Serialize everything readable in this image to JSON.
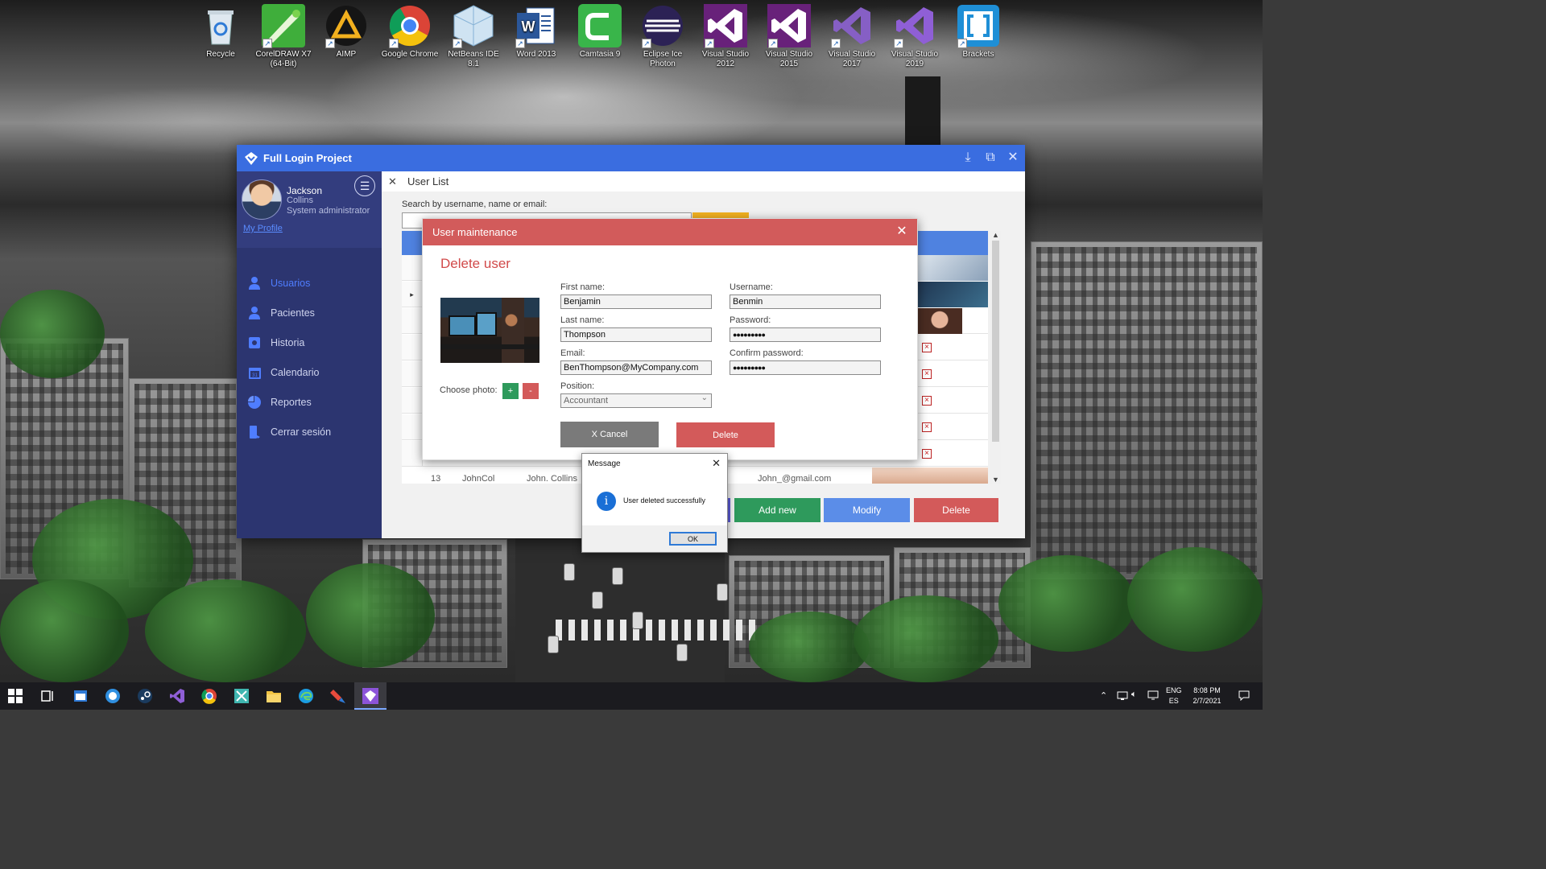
{
  "desktop_icons": [
    {
      "label": "Recycle",
      "icon": "recycle-bin-icon"
    },
    {
      "label": "CorelDRAW X7 (64-Bit)",
      "icon": "coreldraw-icon"
    },
    {
      "label": "AIMP",
      "icon": "aimp-icon"
    },
    {
      "label": "Google Chrome",
      "icon": "chrome-icon"
    },
    {
      "label": "NetBeans IDE 8.1",
      "icon": "netbeans-icon"
    },
    {
      "label": "Word 2013",
      "icon": "word-icon"
    },
    {
      "label": "Camtasia 9",
      "icon": "camtasia-icon"
    },
    {
      "label": "Eclipse Ice Photon",
      "icon": "eclipse-icon"
    },
    {
      "label": "Visual Studio 2012",
      "icon": "visual-studio-icon"
    },
    {
      "label": "Visual Studio 2015",
      "icon": "visual-studio-icon"
    },
    {
      "label": "Visual Studio 2017",
      "icon": "visual-studio-icon"
    },
    {
      "label": "Visual Studio 2019",
      "icon": "visual-studio-icon"
    },
    {
      "label": "Brackets",
      "icon": "brackets-icon"
    }
  ],
  "app": {
    "title": "Full Login Project",
    "profile": {
      "first_name": "Jackson",
      "last_name": "Collins",
      "role": "System administrator",
      "link": "My Profile"
    },
    "nav": [
      {
        "label": "Usuarios",
        "icon": "user-icon",
        "active": true
      },
      {
        "label": "Pacientes",
        "icon": "patient-icon",
        "active": false
      },
      {
        "label": "Historia",
        "icon": "history-icon",
        "active": false
      },
      {
        "label": "Calendario",
        "icon": "calendar-icon",
        "active": false
      },
      {
        "label": "Reportes",
        "icon": "pie-chart-icon",
        "active": false
      },
      {
        "label": "Cerrar sesión",
        "icon": "logout-icon",
        "active": false
      }
    ],
    "content": {
      "header": "User List",
      "search_label": "Search by username, name or email:",
      "visible_row": {
        "id": "13",
        "username": "JohnCol",
        "name": "John. Collins",
        "email": "John_@gmail.com"
      },
      "buttons": {
        "add": "Add new",
        "modify": "Modify",
        "delete": "Delete"
      }
    }
  },
  "user_maintenance": {
    "title": "User maintenance",
    "heading": "Delete user",
    "labels": {
      "first_name": "First name:",
      "last_name": "Last name:",
      "email": "Email:",
      "position": "Position:",
      "username": "Username:",
      "password": "Password:",
      "confirm_password": "Confirm password:",
      "choose_photo": "Choose photo:"
    },
    "values": {
      "first_name": "Benjamin",
      "last_name": "Thompson",
      "email": "BenThompson@MyCompany.com",
      "position": "Accountant",
      "username": "Benmin",
      "password": "●●●●●●●●●",
      "confirm_password": "●●●●●●●●●"
    },
    "photo_add": "+",
    "photo_remove": "-",
    "cancel": "X  Cancel",
    "delete": "Delete"
  },
  "message_box": {
    "title": "Message",
    "text": "User deleted successfully",
    "ok": "OK"
  },
  "taskbar": {
    "language": "ENG",
    "layout": "ES",
    "time": "8:08 PM",
    "date": "2/7/2021"
  },
  "colors": {
    "app_blue": "#3a6de0",
    "sidebar": "#2c3570",
    "dialog_red": "#d25b5b",
    "add_green": "#2e9a5c",
    "modify_blue": "#5b8de8",
    "delete_red": "#d35a5a"
  }
}
